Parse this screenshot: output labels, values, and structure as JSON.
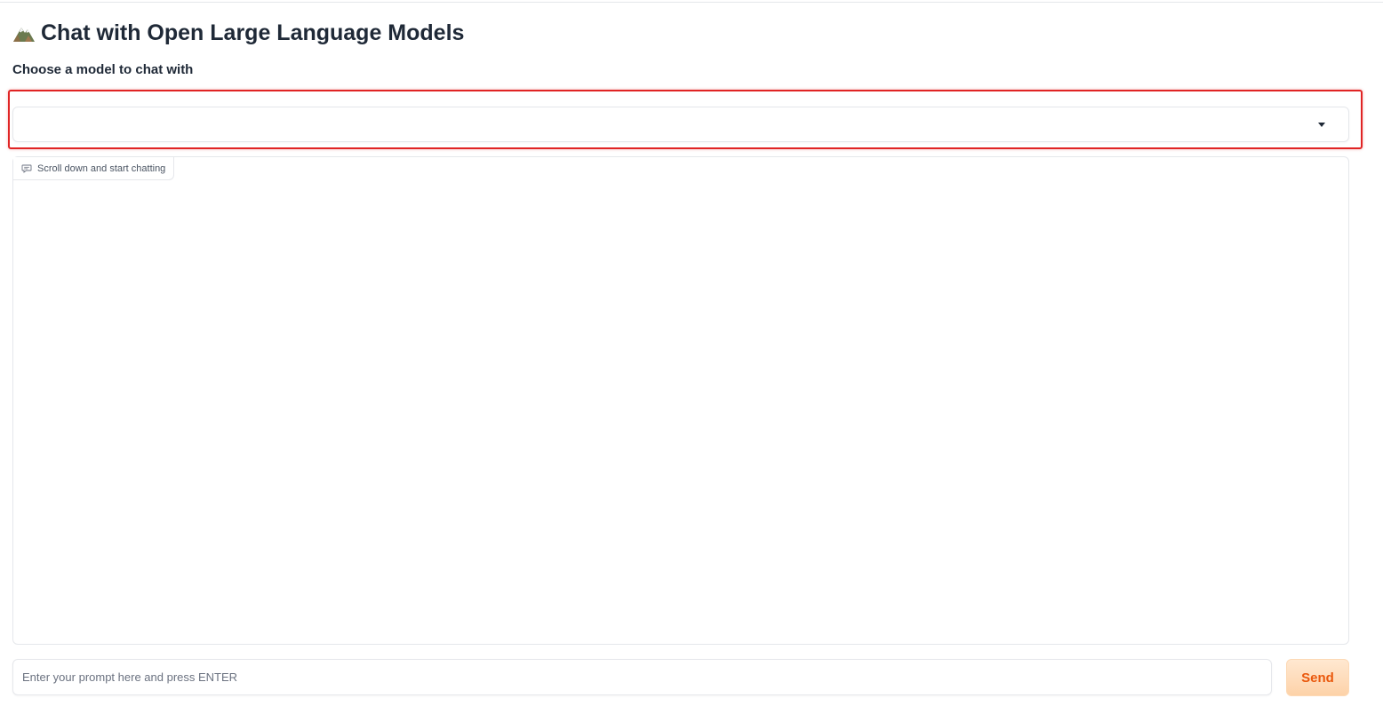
{
  "header": {
    "icon": "mountain-icon",
    "title": "Chat with Open Large Language Models"
  },
  "model_selector": {
    "label": "Choose a model to chat with",
    "selected_value": "",
    "caret_icon": "caret-down-icon",
    "highlight_color": "#e02424"
  },
  "chat": {
    "label": "Scroll down and start chatting",
    "label_icon": "chat-bubble-icon",
    "messages": []
  },
  "prompt": {
    "placeholder": "Enter your prompt here and press ENTER",
    "value": ""
  },
  "send": {
    "label": "Send",
    "accent": "#ea580c"
  }
}
